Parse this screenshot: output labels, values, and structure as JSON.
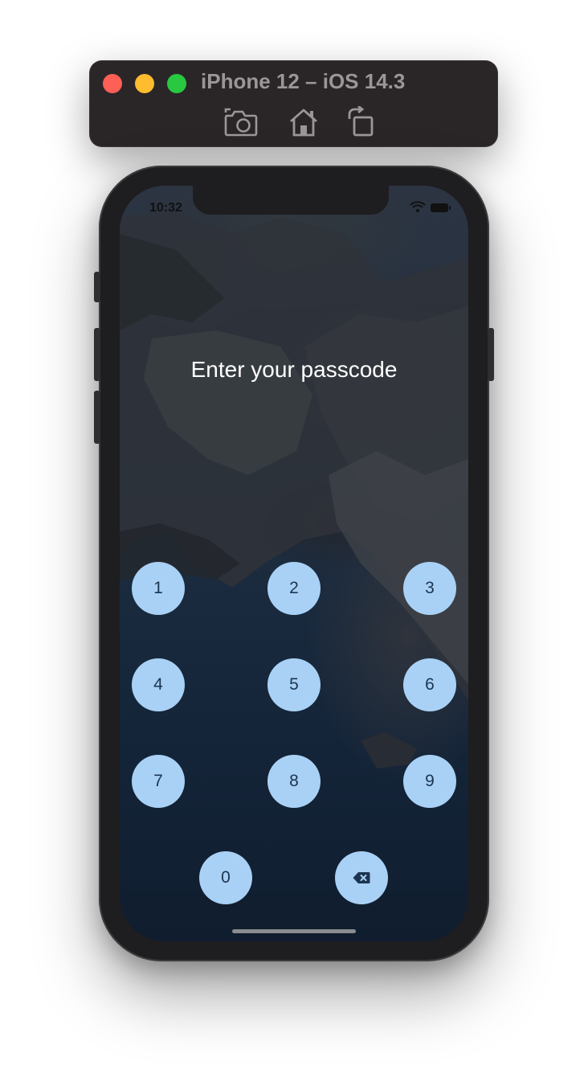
{
  "window": {
    "title": "iPhone 12 – iOS 14.3",
    "toolbar": {
      "screenshot_icon": "camera-icon",
      "home_icon": "home-icon",
      "rotate_icon": "rotate-icon"
    }
  },
  "status_bar": {
    "time": "10:32",
    "wifi_icon": "wifi-icon",
    "battery_icon": "battery-icon"
  },
  "passcode": {
    "prompt": "Enter your passcode",
    "keys": [
      "1",
      "2",
      "3",
      "4",
      "5",
      "6",
      "7",
      "8",
      "9",
      "0"
    ],
    "delete_icon": "backspace-icon"
  },
  "colors": {
    "key_background": "#a9d1f5",
    "key_text": "#1b3550",
    "prompt_text": "#ffffff"
  }
}
